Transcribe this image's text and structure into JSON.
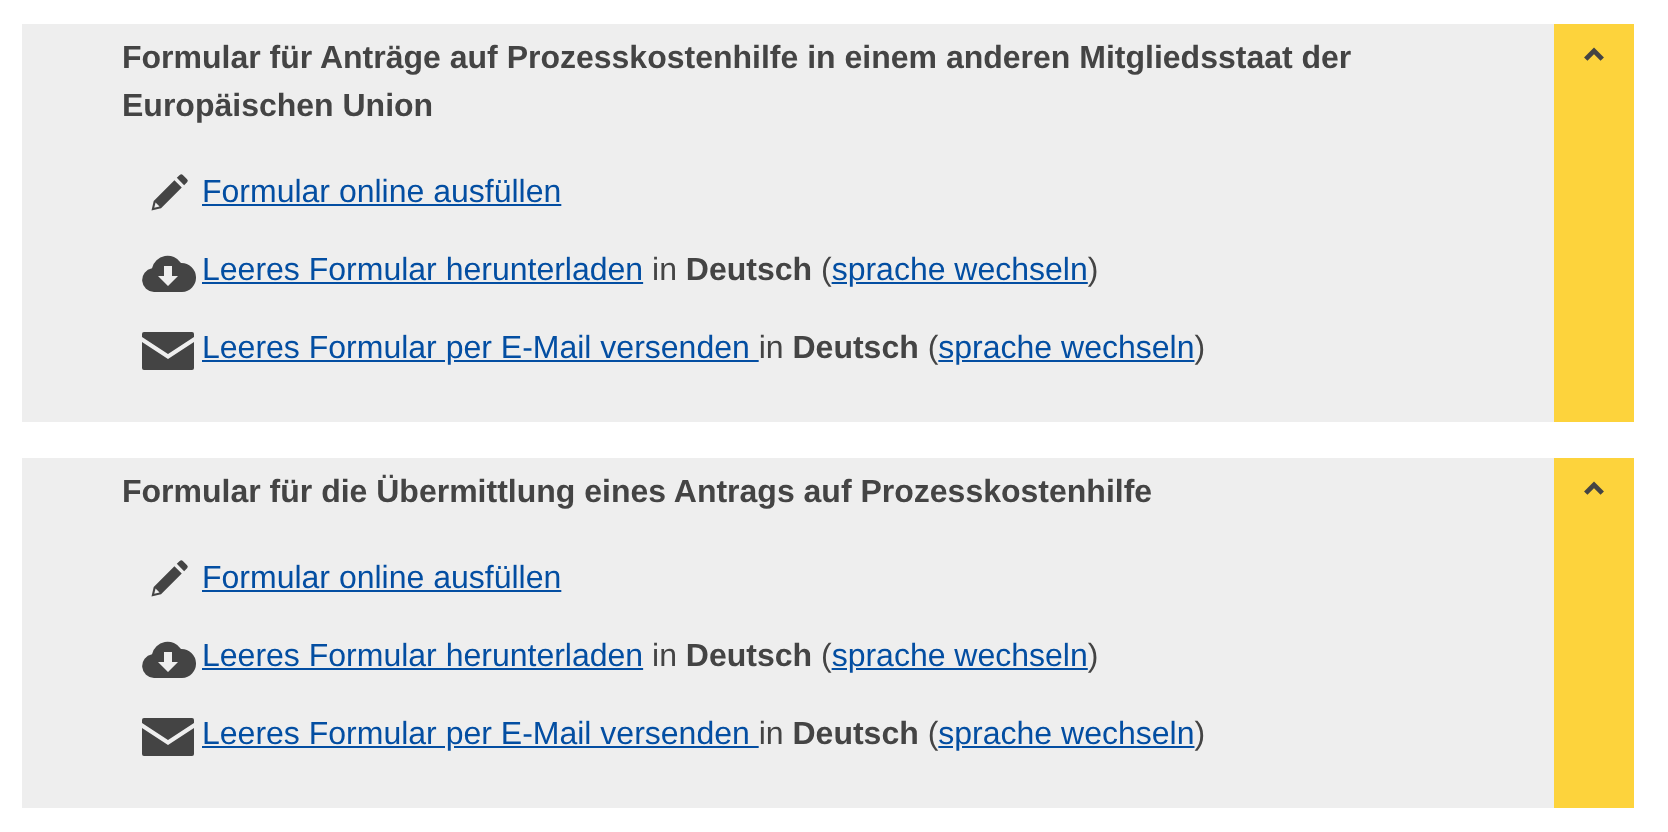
{
  "panels": [
    {
      "title": "Formular für Anträge auf Prozesskostenhilfe in einem anderen Mitgliedsstaat der Europäischen Union",
      "expanded": true,
      "items": [
        {
          "kind": "online",
          "link": "Formular online ausfüllen"
        },
        {
          "kind": "download",
          "link": "Leeres Formular herunterladen",
          "note": " in **Deutsch** (",
          "change_link": "sprache wechseln",
          "close": ")"
        },
        {
          "kind": "email",
          "link": "Leeres Formular per E-Mail versenden ",
          "note": "in **Deutsch** (",
          "change_link": "sprache wechseln",
          "close": ")"
        }
      ]
    },
    {
      "title": "Formular für die Übermittlung eines Antrags auf Prozesskostenhilfe",
      "expanded": true,
      "items": [
        {
          "kind": "online",
          "link": "Formular online ausfüllen"
        },
        {
          "kind": "download",
          "link": "Leeres Formular herunterladen",
          "note": " in **Deutsch** (",
          "change_link": "sprache wechseln",
          "close": ")"
        },
        {
          "kind": "email",
          "link": "Leeres Formular per E-Mail versenden ",
          "note": "in **Deutsch** (",
          "change_link": "sprache wechseln",
          "close": ")"
        }
      ]
    }
  ]
}
